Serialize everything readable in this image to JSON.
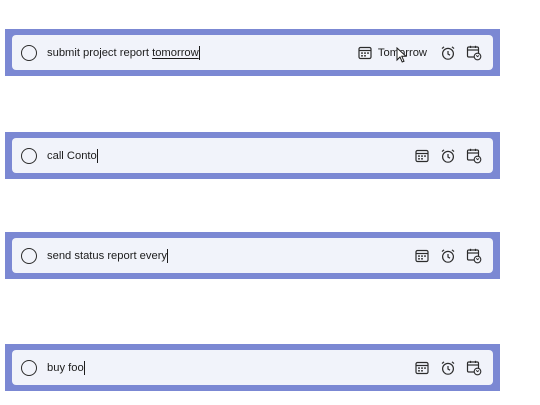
{
  "tasks": [
    {
      "text_plain": "submit project report ",
      "text_highlight": "tomorrow",
      "due_label": "Tomorrow",
      "icons": [
        "due-date-icon",
        "reminder-icon",
        "repeat-icon"
      ]
    },
    {
      "text_plain": "call Conto",
      "icons": [
        "due-date-icon",
        "reminder-icon",
        "repeat-icon"
      ]
    },
    {
      "text_plain": "send status report every",
      "icons": [
        "due-date-icon",
        "reminder-icon",
        "repeat-icon"
      ]
    },
    {
      "text_plain": "buy foo",
      "icons": [
        "due-date-icon",
        "reminder-icon",
        "repeat-icon"
      ]
    }
  ],
  "colors": {
    "bar_border": "#7b88d3",
    "field_bg": "#f1f3fa",
    "text": "#1c1c1c"
  }
}
